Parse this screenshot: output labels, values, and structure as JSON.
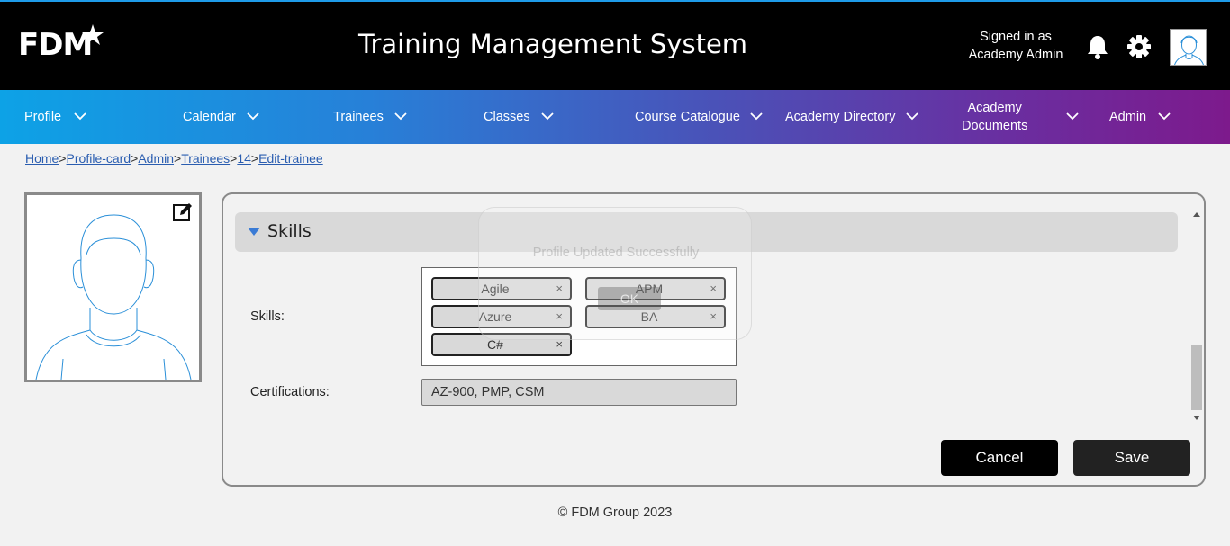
{
  "header": {
    "logo_text": "FDM",
    "title": "Training Management System",
    "signed_in_line1": "Signed in as",
    "signed_in_line2": "Academy Admin",
    "icons": [
      "bell-icon",
      "gear-icon",
      "user-avatar"
    ]
  },
  "nav": {
    "items": [
      {
        "label": "Profile"
      },
      {
        "label": "Calendar"
      },
      {
        "label": "Trainees"
      },
      {
        "label": "Classes"
      },
      {
        "label": "Course Catalogue"
      },
      {
        "label": "Academy Directory"
      },
      {
        "label": "Academy\nDocuments",
        "line1": "Academy",
        "line2": "Documents"
      },
      {
        "label": "Admin"
      }
    ]
  },
  "breadcrumb": {
    "items": [
      "Home",
      "Profile-card",
      "Admin",
      "Trainees",
      "14",
      "Edit-trainee"
    ],
    "separator": ">"
  },
  "section": {
    "title": "Skills"
  },
  "form": {
    "skills_label": "Skills:",
    "skills": [
      "Agile",
      "APM",
      "Azure",
      "BA",
      "C#"
    ],
    "chip_remove": "×",
    "certifications_label": "Certifications:",
    "certifications_value": "AZ-900, PMP, CSM"
  },
  "buttons": {
    "cancel": "Cancel",
    "save": "Save"
  },
  "toast": {
    "message": "Profile Updated Successfully",
    "ok": "OK"
  },
  "footer": {
    "text": "© FDM Group 2023"
  },
  "colors": {
    "topbar": "#000000",
    "nav_gradient_start": "#0da2e6",
    "nav_gradient_end": "#7d1a8c",
    "accent": "#3a7bd5"
  }
}
